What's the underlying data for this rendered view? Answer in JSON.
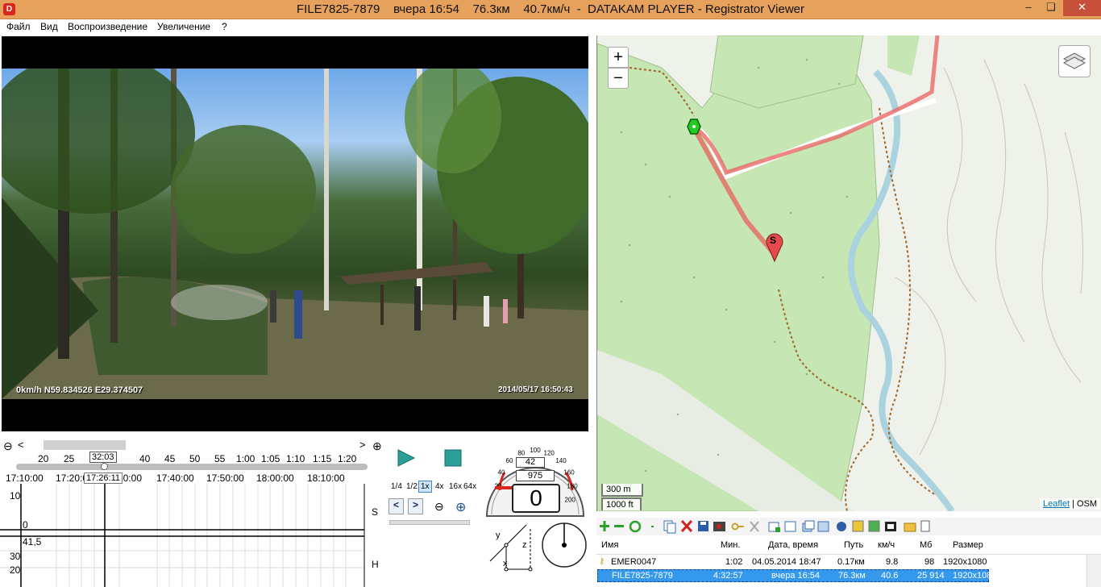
{
  "window": {
    "title": "FILE7825-7879    вчера 16:54    76.3км    40.7км/ч  -  DATAKAM PLAYER - Registrator Viewer",
    "app_icon": "D",
    "minimize_icon": "‒",
    "maximize_icon": "❏",
    "close_icon": "✕",
    "titlebar_color": "#e6a15c",
    "close_color": "#c7503a"
  },
  "menu": {
    "items": [
      "Файл",
      "Вид",
      "Воспроизведение",
      "Увеличение",
      "?"
    ]
  },
  "video": {
    "overlay_left": "0km/h N59.834526 E29.374507",
    "overlay_right": "2014/05/17 16:50:43"
  },
  "map": {
    "zoom_in": "+",
    "zoom_out": "−",
    "layers_icon": "layers-icon",
    "scale_metric": "300 m",
    "scale_imperial": "1000 ft",
    "attribution_link": "Leaflet",
    "attribution_sep": " | ",
    "attribution_source": "OSM",
    "start_marker_label": "S",
    "track_color": "#e8605e",
    "forest_color": "#c6e6b4",
    "river_color": "#aad3df"
  },
  "timeline": {
    "zoom_out_icon": "⊖",
    "zoom_in_icon": "⊕",
    "scroll_left": "<",
    "scroll_right": ">",
    "minute_ticks": [
      "20",
      "25",
      "30",
      "35",
      "40",
      "45",
      "50",
      "55",
      "1:00",
      "1:05",
      "1:10",
      "1:15",
      "1:20"
    ],
    "cursor_label": "32:03",
    "time_labels": [
      "17:10:00",
      "17:20:0",
      "17:30:00",
      "17:40:00",
      "17:50:00",
      "18:00:00",
      "18:10:00"
    ],
    "cursor_time": "17:26:11",
    "speed_graph": {
      "y_tick_top": "10",
      "y_tick_zero": "0",
      "label": "S"
    },
    "height_graph": {
      "value": "41,5",
      "y_tick_30": "30",
      "y_tick_20": "20",
      "y_tick_10": "10",
      "y_tick_0": "0",
      "label": "H"
    }
  },
  "controls": {
    "play_icon": "play-icon",
    "stop_icon": "stop-icon",
    "speeds": [
      "1/4",
      "1/2",
      "1x",
      "4x",
      "16x",
      "64x"
    ],
    "selected_speed": "1x",
    "prev_icon": "<",
    "next_icon": ">",
    "zoom_out_icon": "⊖",
    "zoom_in_icon": "⊕",
    "speedometer": {
      "scale": [
        "20",
        "40",
        "60",
        "80",
        "100",
        "120",
        "140",
        "160",
        "180",
        "200"
      ],
      "max_value": 200,
      "trip": "42",
      "odometer": "975",
      "speed": "0",
      "speed_value": 0
    },
    "axes": {
      "x": "x",
      "y": "y",
      "z": "z"
    }
  },
  "file_list": {
    "columns": [
      "Имя",
      "Мин.",
      "Дата, время",
      "Путь",
      "км/ч",
      "Мб",
      "Размер"
    ],
    "rows": [
      {
        "name": "EMER0047",
        "min": "1:02",
        "datetime": "04.05.2014 18:47",
        "path": "0.17км",
        "kmh": "9.8",
        "mb": "98",
        "size": "1920x1080"
      },
      {
        "name": "FILE7825-7879",
        "min": "4:32:57",
        "datetime": "вчера 16:54",
        "path": "76.3км",
        "kmh": "40.6",
        "mb": "25 914",
        "size": "1920x1080"
      }
    ],
    "toolbar_icons": [
      "add-icon",
      "remove-icon",
      "refresh-icon",
      "dot-icon",
      "copy-icon",
      "delete-icon",
      "save-icon",
      "snapshot-icon",
      "key-icon",
      "cut-icon",
      "add-window-icon",
      "fit-icon",
      "window-icon",
      "expand-icon",
      "globe-icon",
      "chart-icon",
      "photo-icon",
      "film-icon",
      "folder-icon",
      "document-icon"
    ]
  }
}
